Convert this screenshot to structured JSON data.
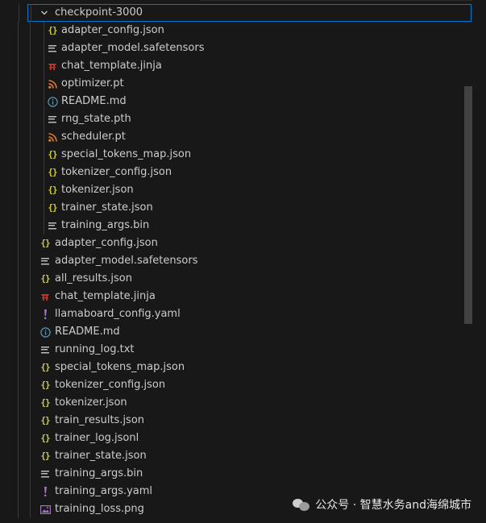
{
  "explorer": {
    "folder": {
      "name": "checkpoint-3000",
      "expanded": true,
      "files": [
        {
          "name": "adapter_config.json",
          "icon": "json-icon"
        },
        {
          "name": "adapter_model.safetensors",
          "icon": "lines-icon"
        },
        {
          "name": "chat_template.jinja",
          "icon": "jinja-icon"
        },
        {
          "name": "optimizer.pt",
          "icon": "rss-icon"
        },
        {
          "name": "README.md",
          "icon": "info-icon"
        },
        {
          "name": "rng_state.pth",
          "icon": "lines-icon"
        },
        {
          "name": "scheduler.pt",
          "icon": "rss-icon"
        },
        {
          "name": "special_tokens_map.json",
          "icon": "json-icon"
        },
        {
          "name": "tokenizer_config.json",
          "icon": "json-icon"
        },
        {
          "name": "tokenizer.json",
          "icon": "json-icon"
        },
        {
          "name": "trainer_state.json",
          "icon": "json-icon"
        },
        {
          "name": "training_args.bin",
          "icon": "lines-icon"
        }
      ]
    },
    "root_files": [
      {
        "name": "adapter_config.json",
        "icon": "json-icon"
      },
      {
        "name": "adapter_model.safetensors",
        "icon": "lines-icon"
      },
      {
        "name": "all_results.json",
        "icon": "json-icon"
      },
      {
        "name": "chat_template.jinja",
        "icon": "jinja-icon"
      },
      {
        "name": "llamaboard_config.yaml",
        "icon": "yaml-icon"
      },
      {
        "name": "README.md",
        "icon": "info-icon"
      },
      {
        "name": "running_log.txt",
        "icon": "lines-icon"
      },
      {
        "name": "special_tokens_map.json",
        "icon": "json-icon"
      },
      {
        "name": "tokenizer_config.json",
        "icon": "json-icon"
      },
      {
        "name": "tokenizer.json",
        "icon": "json-icon"
      },
      {
        "name": "train_results.json",
        "icon": "json-icon"
      },
      {
        "name": "trainer_log.jsonl",
        "icon": "json-icon"
      },
      {
        "name": "trainer_state.json",
        "icon": "json-icon"
      },
      {
        "name": "training_args.bin",
        "icon": "lines-icon"
      },
      {
        "name": "training_args.yaml",
        "icon": "yaml-icon"
      },
      {
        "name": "training_loss.png",
        "icon": "image-icon"
      }
    ]
  },
  "watermark": {
    "text": "公众号 · 智慧水务and海绵城市"
  },
  "colors": {
    "background": "#181818",
    "text": "#cccccc",
    "selection_border": "#0078d4",
    "json": "#cbcb41",
    "jinja": "#c8312a",
    "rss": "#e37933",
    "info": "#519aba",
    "yaml": "#a074c4"
  }
}
